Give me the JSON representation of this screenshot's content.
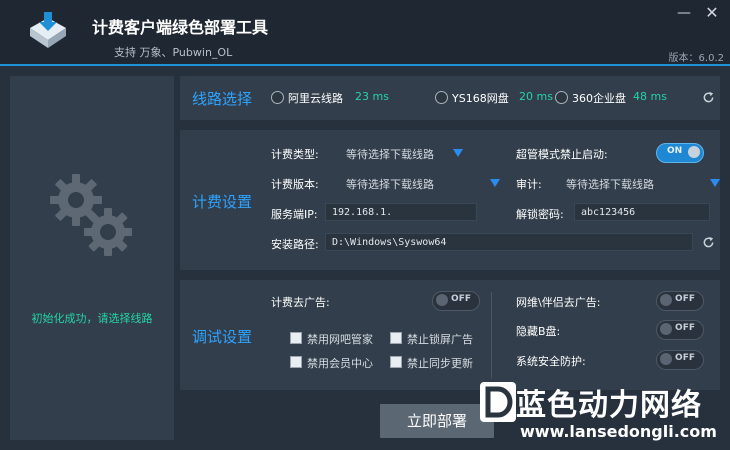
{
  "header": {
    "title": "计费客户端绿色部署工具",
    "subtitle": "支持 万象、Pubwin_OL",
    "version": "版本：6.0.2"
  },
  "window_controls": {
    "minimize": "—",
    "close": "✕"
  },
  "left": {
    "status": "初始化成功，请选择线路"
  },
  "route": {
    "title": "线路选择",
    "options": [
      {
        "label": "阿里云线路",
        "latency": "23 ms"
      },
      {
        "label": "YS168网盘",
        "latency": "20 ms"
      },
      {
        "label": "360企业盘",
        "latency": "48 ms"
      }
    ]
  },
  "billing": {
    "title": "计费设置",
    "type_label": "计费类型:",
    "type_value": "等待选择下载线路",
    "version_label": "计费版本:",
    "version_value": "等待选择下载线路",
    "super_label": "超管模式禁止启动:",
    "super_toggle": "ON",
    "audit_label": "审计:",
    "audit_value": "等待选择下载线路",
    "server_label": "服务端IP:",
    "server_value": "192.168.1.",
    "unlock_label": "解锁密码:",
    "unlock_value": "abc123456",
    "path_label": "安装路径:",
    "path_value": "D:\\Windows\\Syswow64"
  },
  "debug": {
    "title": "调试设置",
    "ads_label": "计费去广告:",
    "ads_toggle": "OFF",
    "checkboxes": [
      "禁用网吧管家",
      "禁止锁屏广告",
      "禁用会员中心",
      "禁止同步更新"
    ],
    "right_items": [
      {
        "label": "网维\\伴侣去广告:",
        "toggle": "OFF"
      },
      {
        "label": "隐藏B盘:",
        "toggle": "OFF"
      },
      {
        "label": "系统安全防护:",
        "toggle": "OFF"
      }
    ]
  },
  "deploy_button": "立即部署",
  "watermark": {
    "name": "蓝色动力网络",
    "url": "www.lansedongli.com"
  },
  "colors": {
    "accent": "#1f8fd6",
    "section_title": "#2ea3ff",
    "latency": "#25d3a7"
  }
}
